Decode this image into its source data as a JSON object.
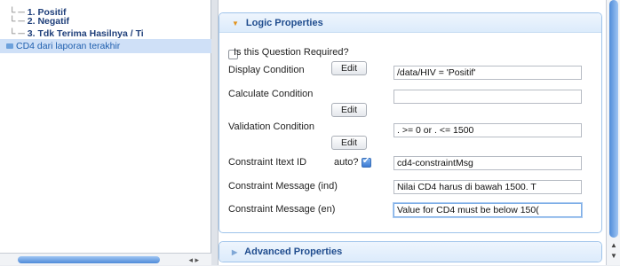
{
  "tree": {
    "items": [
      {
        "connector": "└ ─",
        "label": "1. Positif"
      },
      {
        "connector": "└ ─",
        "label": "2. Negatif"
      },
      {
        "connector": "└ ─",
        "label": "3. Tdk Terima Hasilnya / Ti"
      },
      {
        "connector": "",
        "label": "CD4 dari laporan terakhir"
      }
    ],
    "scroll_arrows": "◂ ▸"
  },
  "logic": {
    "header": "Logic Properties",
    "required_label": "Is this Question Required?",
    "display_condition_label": "Display Condition",
    "display_condition_value": "/data/HIV = 'Positif'",
    "calculate_condition_label": "Calculate Condition",
    "calculate_condition_value": "",
    "validation_condition_label": "Validation Condition",
    "validation_condition_value": ". >= 0 or . <= 1500",
    "constraint_itext_label": "Constraint Itext ID",
    "auto_label": "auto?",
    "constraint_itext_value": "cd4-constraintMsg",
    "constraint_msg_ind_label": "Constraint Message (ind)",
    "constraint_msg_ind_value": "Nilai CD4 harus di bawah 1500. T",
    "constraint_msg_en_label": "Constraint Message (en)",
    "constraint_msg_en_value": "Value for CD4 must be below 150(",
    "edit_label": "Edit"
  },
  "advanced": {
    "header": "Advanced Properties"
  },
  "scrollbar": {
    "up_arrow": "▲",
    "down_arrow": "▼"
  },
  "state": {
    "required_checked": false,
    "auto_checked": true
  }
}
